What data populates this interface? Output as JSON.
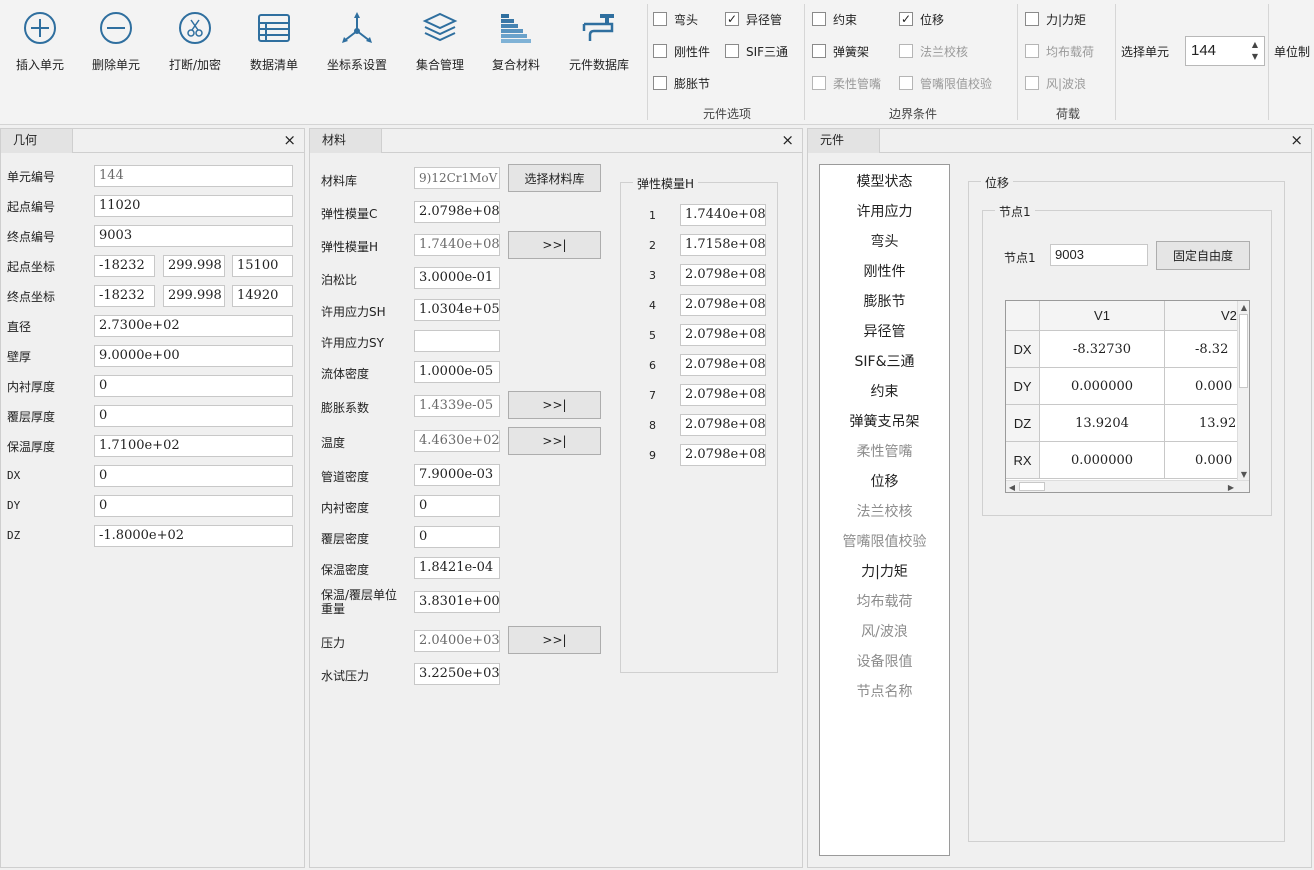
{
  "toolbar": {
    "buttons": [
      {
        "label": "插入单元",
        "icon": "plus-circle-icon"
      },
      {
        "label": "删除单元",
        "icon": "minus-circle-icon"
      },
      {
        "label": "打断/加密",
        "icon": "scissors-icon"
      },
      {
        "label": "数据清单",
        "icon": "list-icon"
      },
      {
        "label": "坐标系设置",
        "icon": "axes-icon"
      },
      {
        "label": "集合管理",
        "icon": "layers-icon"
      },
      {
        "label": "复合材料",
        "icon": "stairs-icon"
      },
      {
        "label": "元件数据库",
        "icon": "faucet-icon"
      }
    ],
    "element_options": {
      "title": "元件选项",
      "items": [
        {
          "label": "弯头",
          "checked": false,
          "enabled": true
        },
        {
          "label": "异径管",
          "checked": true,
          "enabled": true
        },
        {
          "label": "刚性件",
          "checked": false,
          "enabled": true
        },
        {
          "label": "SIF三通",
          "checked": false,
          "enabled": true
        },
        {
          "label": "膨胀节",
          "checked": false,
          "enabled": true
        }
      ]
    },
    "boundary": {
      "title": "边界条件",
      "items": [
        {
          "label": "约束",
          "checked": false,
          "enabled": true
        },
        {
          "label": "位移",
          "checked": true,
          "enabled": true
        },
        {
          "label": "弹簧架",
          "checked": false,
          "enabled": true
        },
        {
          "label": "法兰校核",
          "checked": false,
          "enabled": false
        },
        {
          "label": "柔性管嘴",
          "checked": false,
          "enabled": false
        },
        {
          "label": "管嘴限值校验",
          "checked": false,
          "enabled": false
        }
      ]
    },
    "loads": {
      "title": "荷载",
      "items": [
        {
          "label": "力|力矩",
          "checked": false,
          "enabled": true
        },
        {
          "label": "均布载荷",
          "checked": false,
          "enabled": false
        },
        {
          "label": "风|波浪",
          "checked": false,
          "enabled": false
        }
      ]
    },
    "select_unit_label": "选择单元",
    "select_unit_value": "144",
    "unit_system_label": "单位制",
    "check_mark": "✓"
  },
  "geometry": {
    "tab": "几何",
    "close": "×",
    "rows": [
      {
        "label": "单元编号",
        "values": [
          "144"
        ],
        "readonly": true
      },
      {
        "label": "起点编号",
        "values": [
          "11020"
        ]
      },
      {
        "label": "终点编号",
        "values": [
          "9003"
        ]
      },
      {
        "label": "起点坐标",
        "values": [
          "-18232",
          "299.998",
          "15100"
        ]
      },
      {
        "label": "终点坐标",
        "values": [
          "-18232",
          "299.998",
          "14920"
        ]
      },
      {
        "label": "直径",
        "values": [
          "2.7300e+02"
        ]
      },
      {
        "label": "壁厚",
        "values": [
          "9.0000e+00"
        ]
      },
      {
        "label": "内衬厚度",
        "values": [
          "0"
        ]
      },
      {
        "label": "覆层厚度",
        "values": [
          "0"
        ]
      },
      {
        "label": "保温厚度",
        "values": [
          "1.7100e+02"
        ]
      },
      {
        "label": "DX",
        "values": [
          "0"
        ]
      },
      {
        "label": "DY",
        "values": [
          "0"
        ]
      },
      {
        "label": "DZ",
        "values": [
          "-1.8000e+02"
        ]
      }
    ]
  },
  "material": {
    "tab": "材料",
    "close": "×",
    "rows": [
      {
        "label": "材料库",
        "value": "9)12Cr1MoV",
        "readonly": true,
        "button": "选择材料库"
      },
      {
        "label": "弹性模量C",
        "value": "2.0798e+08"
      },
      {
        "label": "弹性模量H",
        "value": "1.7440e+08",
        "readonly": true,
        "button": ">>|"
      },
      {
        "label": "泊松比",
        "value": "3.0000e-01"
      },
      {
        "label": "许用应力SH",
        "value": "1.0304e+05"
      },
      {
        "label": "许用应力SY",
        "value": ""
      },
      {
        "label": "流体密度",
        "value": "1.0000e-05"
      },
      {
        "label": "膨胀系数",
        "value": "1.4339e-05",
        "readonly": true,
        "button": ">>|"
      },
      {
        "label": "温度",
        "value": "4.4630e+02",
        "readonly": true,
        "button": ">>|"
      },
      {
        "label": "管道密度",
        "value": "7.9000e-03"
      },
      {
        "label": "内衬密度",
        "value": "0"
      },
      {
        "label": "覆层密度",
        "value": "0"
      },
      {
        "label": "保温密度",
        "value": "1.8421e-04"
      },
      {
        "label": "保温/覆层单位重量",
        "value": "3.8301e+00"
      },
      {
        "label": "压力",
        "value": "2.0400e+03",
        "readonly": true,
        "button": ">>|"
      },
      {
        "label": "水试压力",
        "value": "3.2250e+03"
      }
    ],
    "elastic_h": {
      "title": "弹性模量H",
      "rows": [
        {
          "index": "1",
          "value": "1.7440e+08"
        },
        {
          "index": "2",
          "value": "1.7158e+08"
        },
        {
          "index": "3",
          "value": "2.0798e+08"
        },
        {
          "index": "4",
          "value": "2.0798e+08"
        },
        {
          "index": "5",
          "value": "2.0798e+08"
        },
        {
          "index": "6",
          "value": "2.0798e+08"
        },
        {
          "index": "7",
          "value": "2.0798e+08"
        },
        {
          "index": "8",
          "value": "2.0798e+08"
        },
        {
          "index": "9",
          "value": "2.0798e+08"
        }
      ]
    }
  },
  "component": {
    "tab": "元件",
    "close": "×",
    "list": [
      {
        "label": "模型状态",
        "enabled": true
      },
      {
        "label": "许用应力",
        "enabled": true
      },
      {
        "label": "弯头",
        "enabled": true
      },
      {
        "label": "刚性件",
        "enabled": true
      },
      {
        "label": "膨胀节",
        "enabled": true
      },
      {
        "label": "异径管",
        "enabled": true
      },
      {
        "label": "SIF&三通",
        "enabled": true
      },
      {
        "label": "约束",
        "enabled": true
      },
      {
        "label": "弹簧支吊架",
        "enabled": true
      },
      {
        "label": "柔性管嘴",
        "enabled": false
      },
      {
        "label": "位移",
        "enabled": true
      },
      {
        "label": "法兰校核",
        "enabled": false
      },
      {
        "label": "管嘴限值校验",
        "enabled": false
      },
      {
        "label": "力|力矩",
        "enabled": true
      },
      {
        "label": "均布载荷",
        "enabled": false
      },
      {
        "label": "风/波浪",
        "enabled": false
      },
      {
        "label": "设备限值",
        "enabled": false
      },
      {
        "label": "节点名称",
        "enabled": false
      }
    ],
    "displacement": {
      "group_title": "位移",
      "node_group_title": "节点1",
      "node_label": "节点1",
      "node_value": "9003",
      "fix_button": "固定自由度",
      "columns": [
        "V1",
        "V2"
      ],
      "rows": [
        {
          "name": "DX",
          "values": [
            "-8.32730",
            "-8.32"
          ]
        },
        {
          "name": "DY",
          "values": [
            "0.000000",
            "0.000"
          ]
        },
        {
          "name": "DZ",
          "values": [
            "13.9204",
            "13.92"
          ]
        },
        {
          "name": "RX",
          "values": [
            "0.000000",
            "0.000"
          ]
        }
      ]
    }
  }
}
